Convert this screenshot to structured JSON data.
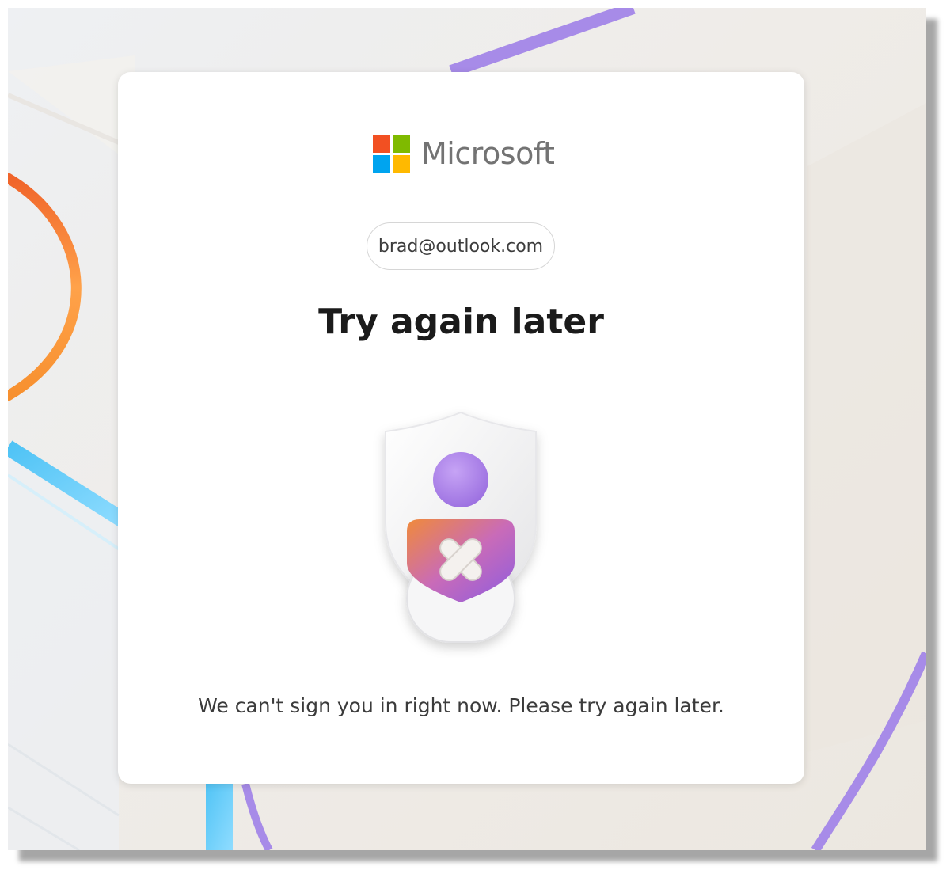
{
  "brand": {
    "name": "Microsoft",
    "logo_colors": [
      "#f25022",
      "#7fba00",
      "#00a4ef",
      "#ffb900"
    ]
  },
  "identity": {
    "email": "brad@outlook.com"
  },
  "main": {
    "title": "Try again later",
    "message": "We can't sign you in right now. Please try again later.",
    "illustration_icon": "shield-user-error-icon"
  },
  "colors": {
    "accent_purple": "#a78be8",
    "accent_orange": "#f5892a",
    "accent_blue": "#5bc8f2"
  }
}
